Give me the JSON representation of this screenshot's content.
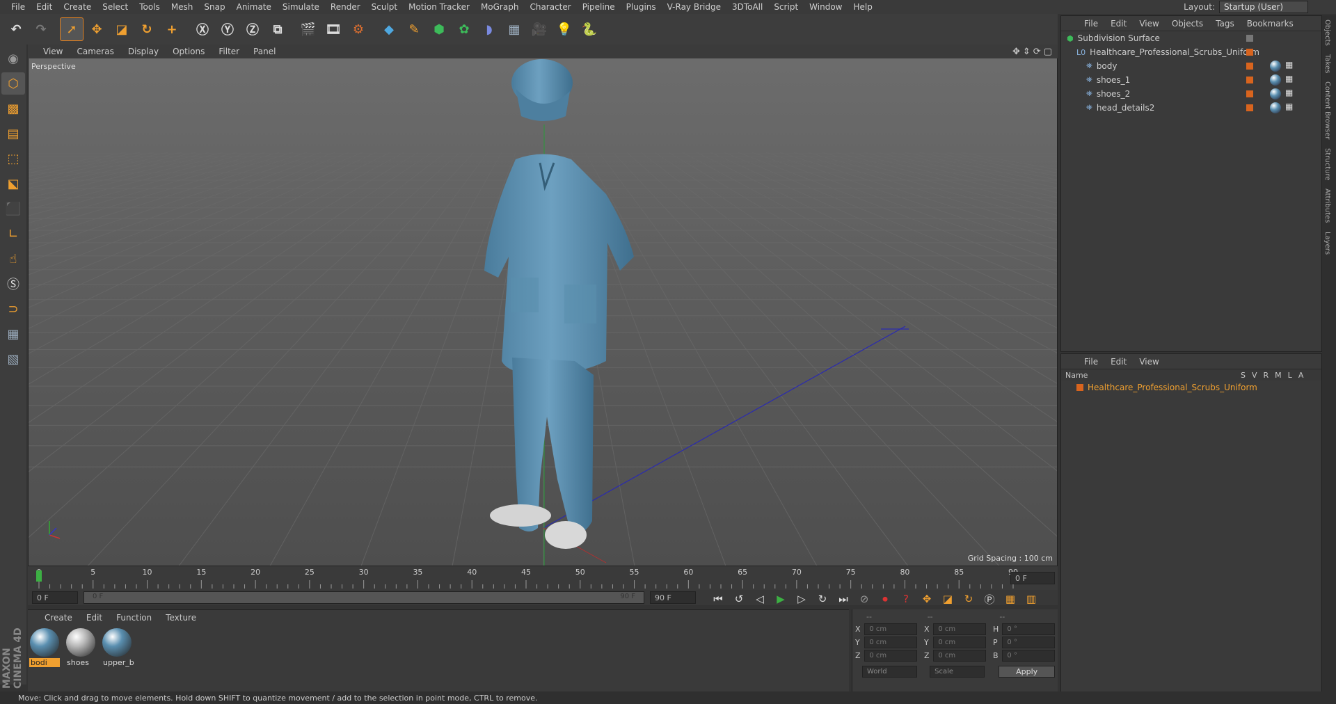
{
  "menu": [
    "File",
    "Edit",
    "Create",
    "Select",
    "Tools",
    "Mesh",
    "Snap",
    "Animate",
    "Simulate",
    "Render",
    "Sculpt",
    "Motion Tracker",
    "MoGraph",
    "Character",
    "Pipeline",
    "Plugins",
    "V-Ray Bridge",
    "3DToAll",
    "Script",
    "Window",
    "Help"
  ],
  "layout": {
    "label": "Layout:",
    "value": "Startup (User)"
  },
  "viewport": {
    "menu": [
      "View",
      "Cameras",
      "Display",
      "Options",
      "Filter",
      "Panel"
    ],
    "label": "Perspective",
    "grid_spacing": "Grid Spacing : 100 cm"
  },
  "timeline": {
    "ticks": [
      "0",
      "5",
      "10",
      "15",
      "20",
      "25",
      "30",
      "35",
      "40",
      "45",
      "50",
      "55",
      "60",
      "65",
      "70",
      "75",
      "80",
      "85",
      "90"
    ],
    "current_frame": "0 F",
    "start_field": "0 F",
    "range_start": "0 F",
    "range_end": "90 F",
    "end_field": "90 F"
  },
  "materials": {
    "menu": [
      "Create",
      "Edit",
      "Function",
      "Texture"
    ],
    "items": [
      {
        "name": "bodi",
        "color": "#5a8fb0",
        "selected": true
      },
      {
        "name": "shoes",
        "color": "#b8b8b8",
        "selected": false
      },
      {
        "name": "upper_b",
        "color": "#5a8fb0",
        "selected": false
      }
    ]
  },
  "coords": {
    "header": [
      "--",
      "--",
      "--"
    ],
    "rows": [
      {
        "a": "X",
        "av": "0 cm",
        "b": "X",
        "bv": "0 cm",
        "c": "H",
        "cv": "0 °"
      },
      {
        "a": "Y",
        "av": "0 cm",
        "b": "Y",
        "bv": "0 cm",
        "c": "P",
        "cv": "0 °"
      },
      {
        "a": "Z",
        "av": "0 cm",
        "b": "Z",
        "bv": "0 cm",
        "c": "B",
        "cv": "0 °"
      }
    ],
    "world": "World",
    "scale": "Scale",
    "apply": "Apply"
  },
  "objects": {
    "menu": [
      "File",
      "Edit",
      "View",
      "Objects",
      "Tags",
      "Bookmarks"
    ],
    "tree": [
      {
        "name": "Subdivision Surface",
        "indent": 0
      },
      {
        "name": "Healthcare_Professional_Scrubs_Uniform",
        "indent": 1
      },
      {
        "name": "body",
        "indent": 2
      },
      {
        "name": "shoes_1",
        "indent": 2
      },
      {
        "name": "shoes_2",
        "indent": 2
      },
      {
        "name": "head_details2",
        "indent": 2
      }
    ]
  },
  "layers": {
    "menu": [
      "File",
      "Edit",
      "View"
    ],
    "columns": {
      "name": "Name",
      "s": "S",
      "v": "V",
      "r": "R",
      "m": "M",
      "l": "L",
      "a": "A"
    },
    "items": [
      "Healthcare_Professional_Scrubs_Uniform"
    ]
  },
  "right_tabs": [
    "Objects",
    "Takes",
    "Content Browser",
    "Structure",
    "Attributes",
    "Layers"
  ],
  "brand": "MAXON CINEMA 4D",
  "status": "Move: Click and drag to move elements. Hold down SHIFT to quantize movement / add to the selection in point mode, CTRL to remove."
}
